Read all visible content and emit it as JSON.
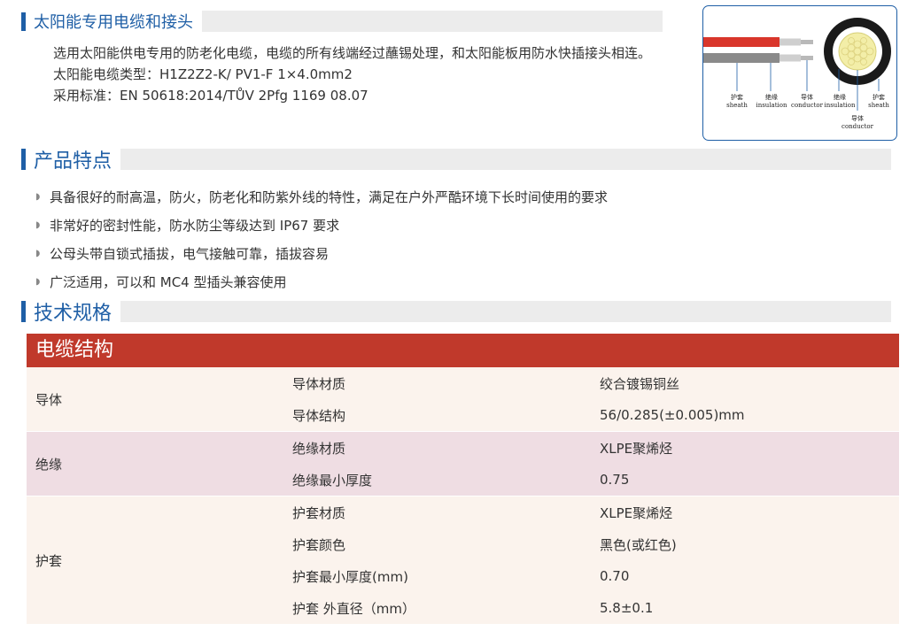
{
  "section1": {
    "title": "太阳能专用电缆和接头"
  },
  "intro": {
    "paragraph": "选用太阳能供电专用的防老化电缆，电缆的所有线端经过蘸锡处理，和太阳能板用防水快插接头相连。",
    "cable_type": "太阳能电缆类型：H1Z2Z2-K/ PV1-F  1×4.0mm2",
    "standard": "采用标准：EN 50618:2014/TŮV 2Pfg 1169 08.07"
  },
  "diagram": {
    "labels": [
      {
        "cn": "护套",
        "en": "sheath"
      },
      {
        "cn": "绝缘",
        "en": "insulation"
      },
      {
        "cn": "导体",
        "en": "conductor"
      },
      {
        "cn": "绝缘",
        "en": "insulation"
      },
      {
        "cn": "护套",
        "en": "sheath"
      }
    ],
    "center_label": {
      "cn": "导体",
      "en": "conductor"
    },
    "colors": {
      "red_cable": "#d9362b",
      "gray_cable": "#8a8a8a",
      "jacket": "#1a1a1a",
      "conductor": "#f3eea8"
    }
  },
  "section2": {
    "title": "产品特点"
  },
  "features": [
    "具备很好的耐高温，防火，防老化和防紫外线的特性，满足在户外严酷环境下长时间使用的要求",
    "非常好的密封性能，防水防尘等级达到 IP67 要求",
    "公母头带自锁式插拔，电气接触可靠，插拔容易",
    "广泛适用，可以和 MC4 型插头兼容使用"
  ],
  "section3": {
    "title": "技术规格"
  },
  "table": {
    "header": "电缆结构",
    "groups": [
      {
        "name": "导体",
        "rows": [
          {
            "param": "导体材质",
            "value": "绞合镀锡铜丝"
          },
          {
            "param": "导体结构",
            "value": "56/0.285(±0.005)mm"
          }
        ]
      },
      {
        "name": "绝缘",
        "rows": [
          {
            "param": "绝缘材质",
            "value": "XLPE聚烯烃"
          },
          {
            "param": "绝缘最小厚度",
            "value": "0.75"
          }
        ]
      },
      {
        "name": "护套",
        "rows": [
          {
            "param": "护套材质",
            "value": "XLPE聚烯烃"
          },
          {
            "param": "护套颜色",
            "value": "黑色(或红色)"
          },
          {
            "param": "护套最小厚度(mm)",
            "value": "0.70"
          },
          {
            "param": " 护套 外直径（mm）",
            "value": "5.8±0.1"
          }
        ]
      }
    ]
  },
  "colors": {
    "accent_blue": "#1f5fa6",
    "table_header_red": "#c0392b"
  }
}
